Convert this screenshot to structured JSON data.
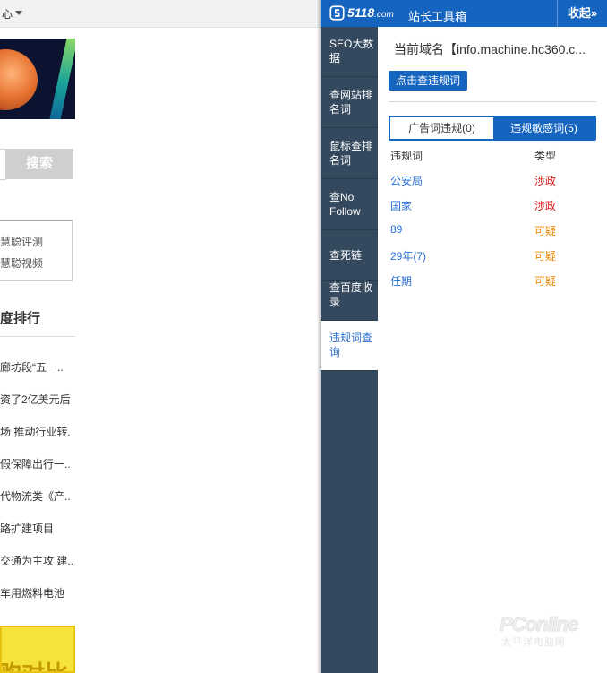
{
  "background_page": {
    "topbar_text": "心",
    "search_button": "搜索",
    "links": [
      "慧聪评测",
      "慧聪视频"
    ],
    "rank_title": "度排行",
    "news": [
      "廊坊段“五一..",
      "资了2亿美元后",
      "场 推动行业转.",
      "假保障出行一..",
      "代物流类《产..",
      "路扩建项目",
      "交通为主攻 建..",
      "车用燃料电池"
    ],
    "ad_text": "购对比"
  },
  "toolbox": {
    "brand": "5118",
    "brand_domain": ".com",
    "title": "站长工具箱",
    "collapse_label": "收起»",
    "nav": [
      "SEO大数据",
      "查网站排名词",
      "鼠标查排名词",
      "查No Follow",
      "查死链",
      "查百度收录",
      "违规词查询"
    ],
    "active_nav_index": 6,
    "domain_label": "当前域名【info.machine.hc360.c...",
    "check_button": "点击查违规词",
    "tabs": [
      "广告词违规(0)",
      "违规敏感词(5)"
    ],
    "active_tab_index": 1,
    "table_headers": [
      "违规词",
      "类型"
    ],
    "rows": [
      {
        "word": "公安局",
        "type": "涉政",
        "type_color": "#e02020"
      },
      {
        "word": "国家",
        "type": "涉政",
        "type_color": "#e02020"
      },
      {
        "word": "89",
        "type": "可疑",
        "type_color": "#f08a00"
      },
      {
        "word": "29年(7)",
        "type": "可疑",
        "type_color": "#f08a00"
      },
      {
        "word": "任期",
        "type": "可疑",
        "type_color": "#f08a00"
      }
    ]
  },
  "watermark": {
    "line1": "PConline",
    "line2": "太平洋电脑网"
  }
}
